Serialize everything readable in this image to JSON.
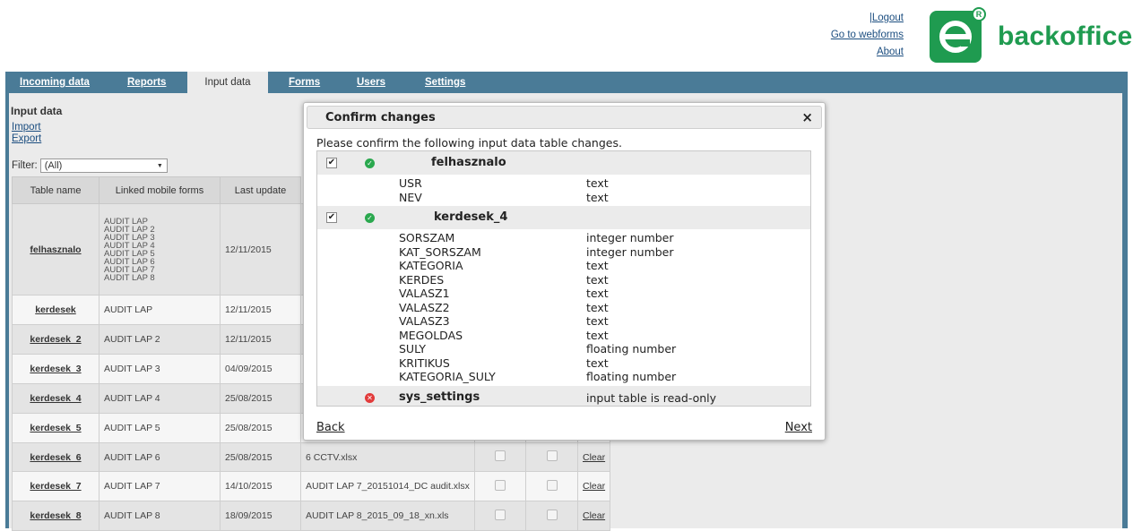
{
  "top_links": {
    "logout": "Logout",
    "separator": "|",
    "webforms": "Go to webforms",
    "about": "About"
  },
  "brand": {
    "name": "backoffice",
    "mark": "e",
    "reg": "R",
    "color": "#1f9b50"
  },
  "nav": {
    "tabs": [
      {
        "label": "Incoming data",
        "active": false
      },
      {
        "label": "Reports",
        "active": false
      },
      {
        "label": "Input data",
        "active": true
      },
      {
        "label": "Forms",
        "active": false
      },
      {
        "label": "Users",
        "active": false
      },
      {
        "label": "Settings",
        "active": false
      }
    ],
    "bar_color": "#4a7b97"
  },
  "panel": {
    "title": "Input data",
    "import_label": "Import",
    "export_label": "Export",
    "filter_label": "Filter:",
    "filter_value": "(All)"
  },
  "table": {
    "headers": [
      "Table name",
      "Linked mobile forms",
      "Last update"
    ],
    "rows": [
      {
        "name": "felhasznalo",
        "forms": [
          "AUDIT LAP",
          "AUDIT LAP 2",
          "AUDIT LAP 3",
          "AUDIT LAP 4",
          "AUDIT LAP 5",
          "AUDIT LAP 6",
          "AUDIT LAP 7",
          "AUDIT LAP 8"
        ],
        "date": "12/11/2015"
      },
      {
        "name": "kerdesek",
        "forms": [
          "AUDIT LAP"
        ],
        "date": "12/11/2015"
      },
      {
        "name": "kerdesek_2",
        "forms": [
          "AUDIT LAP 2"
        ],
        "date": "12/11/2015"
      },
      {
        "name": "kerdesek_3",
        "forms": [
          "AUDIT LAP 3"
        ],
        "date": "04/09/2015"
      },
      {
        "name": "kerdesek_4",
        "forms": [
          "AUDIT LAP 4"
        ],
        "date": "25/08/2015"
      },
      {
        "name": "kerdesek_5",
        "forms": [
          "AUDIT LAP 5"
        ],
        "date": "25/08/2015"
      },
      {
        "name": "kerdesek_6",
        "forms": [
          "AUDIT LAP 6"
        ],
        "date": "25/08/2015",
        "file": "6 CCTV.xlsx",
        "action": "Clear"
      },
      {
        "name": "kerdesek_7",
        "forms": [
          "AUDIT LAP 7"
        ],
        "date": "14/10/2015",
        "file": "AUDIT LAP 7_20151014_DC audit.xlsx",
        "action": "Clear"
      },
      {
        "name": "kerdesek_8",
        "forms": [
          "AUDIT LAP 8"
        ],
        "date": "18/09/2015",
        "file": "AUDIT LAP 8_2015_09_18_xn.xls",
        "action": "Clear"
      }
    ]
  },
  "modal": {
    "title": "Confirm changes",
    "close": "×",
    "message": "Please confirm the following input data table changes.",
    "groups": [
      {
        "name": "felhasznalo",
        "checked": true,
        "status": "ok",
        "fields": [
          {
            "name": "USR",
            "type": "text"
          },
          {
            "name": "NEV",
            "type": "text"
          }
        ]
      },
      {
        "name": "kerdesek_4",
        "checked": true,
        "status": "ok",
        "fields": [
          {
            "name": "SORSZAM",
            "type": "integer number"
          },
          {
            "name": "KAT_SORSZAM",
            "type": "integer number"
          },
          {
            "name": "KATEGORIA",
            "type": "text"
          },
          {
            "name": "KERDES",
            "type": "text"
          },
          {
            "name": "VALASZ1",
            "type": "text"
          },
          {
            "name": "VALASZ2",
            "type": "text"
          },
          {
            "name": "VALASZ3",
            "type": "text"
          },
          {
            "name": "MEGOLDAS",
            "type": "text"
          },
          {
            "name": "SULY",
            "type": "floating number"
          },
          {
            "name": "KRITIKUS",
            "type": "text"
          },
          {
            "name": "KATEGORIA_SULY",
            "type": "floating number"
          }
        ]
      },
      {
        "name": "sys_settings",
        "checked": false,
        "status": "error",
        "note": "input table is read-only",
        "fields": []
      }
    ],
    "back_label": "Back",
    "next_label": "Next"
  }
}
